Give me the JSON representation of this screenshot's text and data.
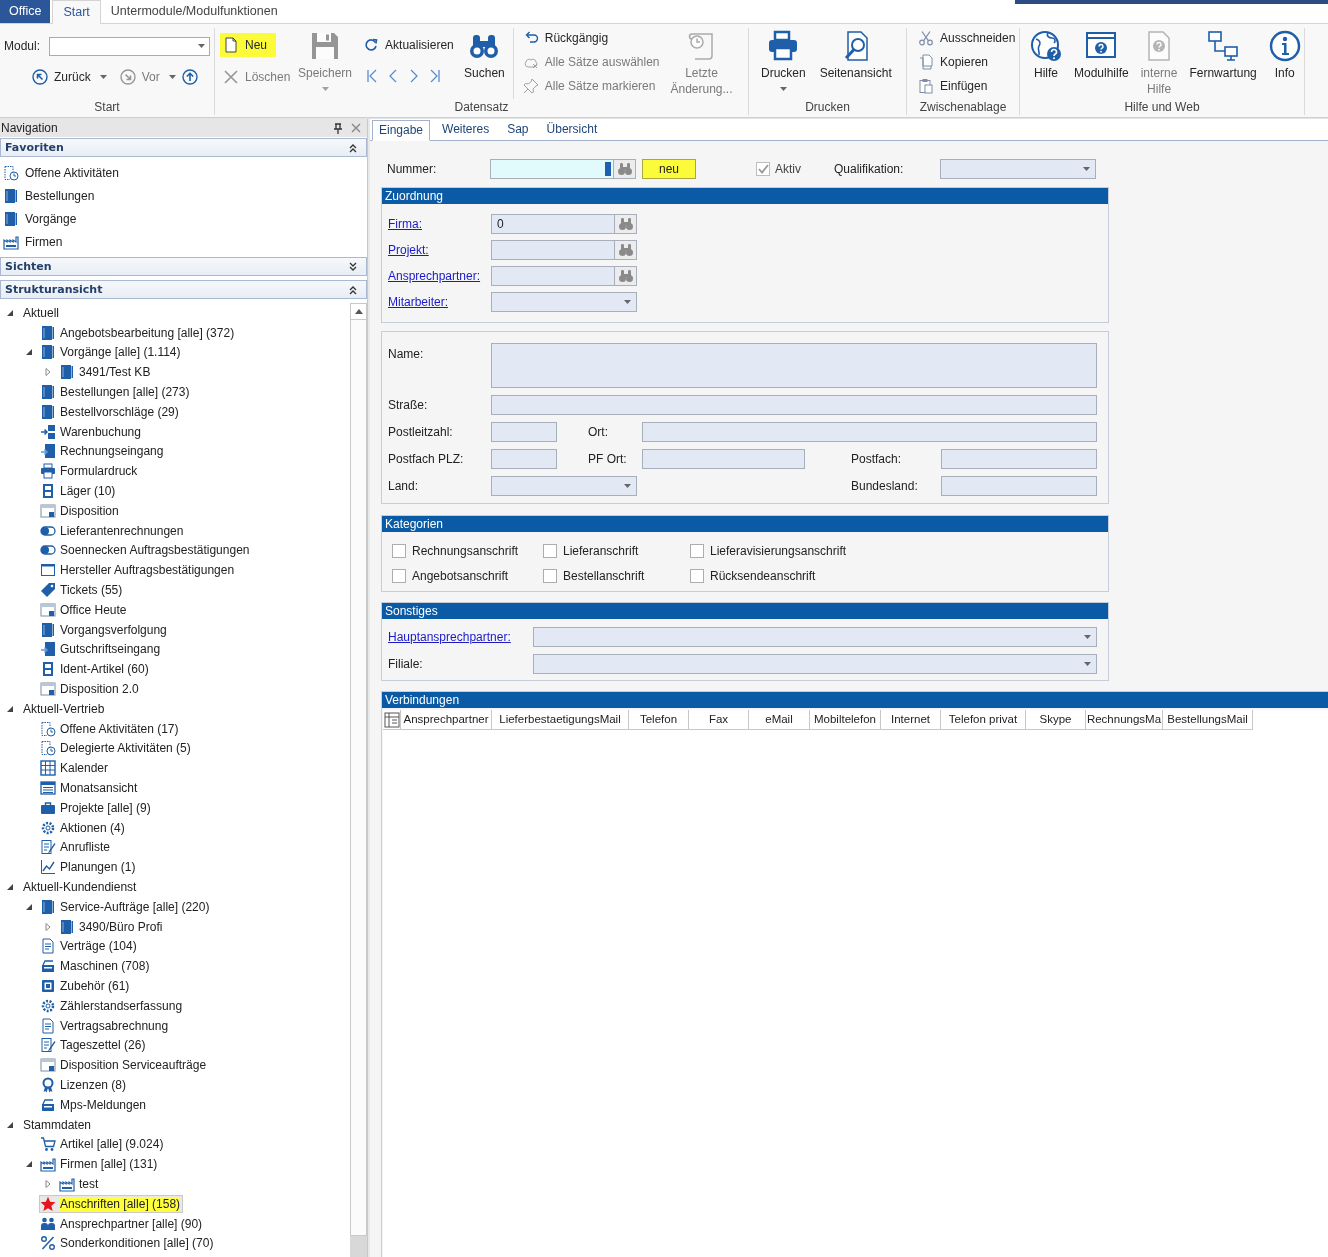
{
  "ribbon": {
    "tabs": [
      {
        "label": "Office",
        "kind": "file",
        "selected": false
      },
      {
        "label": "Start",
        "kind": "tab",
        "selected": true
      },
      {
        "label": "Untermodule/Modulfunktionen",
        "kind": "tab",
        "selected": false
      }
    ],
    "start_group": {
      "title": "Start",
      "module_label": "Modul:",
      "back": {
        "label": "Zurück",
        "disabled": false
      },
      "forward": {
        "label": "Vor",
        "disabled": true
      }
    },
    "record_group": {
      "title": "Datensatz",
      "buttons": [
        {
          "label": "Neu",
          "disabled": false,
          "highlighted": true
        },
        {
          "label": "Löschen",
          "disabled": true,
          "highlighted": false
        },
        {
          "label": "Speichern",
          "disabled": true,
          "highlighted": false
        },
        {
          "label": "Aktualisieren",
          "disabled": false,
          "highlighted": false
        },
        {
          "label": "Suchen",
          "disabled": false,
          "highlighted": false
        },
        {
          "label": "Rückgängig",
          "disabled": false,
          "highlighted": false
        },
        {
          "label": "Alle Sätze auswählen",
          "disabled": true,
          "highlighted": false
        },
        {
          "label": "Alle Sätze markieren",
          "disabled": true,
          "highlighted": false
        },
        {
          "label": "Letzte Änderung...",
          "disabled": true,
          "highlighted": false
        }
      ]
    },
    "print_group": {
      "title": "Drucken",
      "buttons": [
        {
          "label": "Drucken",
          "disabled": false
        },
        {
          "label": "Seitenansicht",
          "disabled": false
        }
      ]
    },
    "clipboard_group": {
      "title": "Zwischenablage",
      "buttons": [
        {
          "label": "Ausschneiden",
          "disabled": false
        },
        {
          "label": "Kopieren",
          "disabled": false
        },
        {
          "label": "Einfügen",
          "disabled": false
        }
      ]
    },
    "help_group": {
      "title": "Hilfe und Web",
      "buttons": [
        {
          "label": "Hilfe",
          "disabled": false
        },
        {
          "label": "Modulhilfe",
          "disabled": false
        },
        {
          "label": "interne Hilfe",
          "disabled": true
        },
        {
          "label": "Fernwartung",
          "disabled": false
        },
        {
          "label": "Info",
          "disabled": false
        }
      ]
    }
  },
  "navigation": {
    "title": "Navigation",
    "favorites": {
      "title": "Favoriten",
      "expanded": true,
      "items": [
        {
          "label": "Offene Aktivitäten"
        },
        {
          "label": "Bestellungen"
        },
        {
          "label": "Vorgänge"
        },
        {
          "label": "Firmen"
        }
      ]
    },
    "views": {
      "title": "Sichten",
      "expanded": false
    },
    "structure": {
      "title": "Strukturansicht",
      "expanded": true,
      "tree": [
        {
          "label": "Aktuell",
          "expanded": true,
          "selected": false,
          "highlighted": false,
          "children": [
            {
              "label": "Angebotsbearbeitung [alle] (372)",
              "selected": false,
              "highlighted": false
            },
            {
              "label": "Vorgänge [alle] (1.114)",
              "expanded": true,
              "selected": false,
              "highlighted": false,
              "children": [
                {
                  "label": "3491/Test KB",
                  "expanded": false,
                  "selected": false,
                  "highlighted": false
                }
              ]
            },
            {
              "label": "Bestellungen [alle] (273)",
              "selected": false,
              "highlighted": false
            },
            {
              "label": "Bestellvorschläge (29)",
              "selected": false,
              "highlighted": false
            },
            {
              "label": "Warenbuchung",
              "selected": false,
              "highlighted": false
            },
            {
              "label": "Rechnungseingang",
              "selected": false,
              "highlighted": false
            },
            {
              "label": "Formulardruck",
              "selected": false,
              "highlighted": false
            },
            {
              "label": "Läger (10)",
              "selected": false,
              "highlighted": false
            },
            {
              "label": "Disposition",
              "selected": false,
              "highlighted": false
            },
            {
              "label": "Lieferantenrechnungen",
              "selected": false,
              "highlighted": false
            },
            {
              "label": "Soennecken Auftragsbestätigungen",
              "selected": false,
              "highlighted": false
            },
            {
              "label": "Hersteller Auftragsbestätigungen",
              "selected": false,
              "highlighted": false
            },
            {
              "label": "Tickets (55)",
              "selected": false,
              "highlighted": false
            },
            {
              "label": "Office Heute",
              "selected": false,
              "highlighted": false
            },
            {
              "label": "Vorgangsverfolgung",
              "selected": false,
              "highlighted": false
            },
            {
              "label": "Gutschriftseingang",
              "selected": false,
              "highlighted": false
            },
            {
              "label": "Ident-Artikel (60)",
              "selected": false,
              "highlighted": false
            },
            {
              "label": "Disposition 2.0",
              "selected": false,
              "highlighted": false
            }
          ]
        },
        {
          "label": "Aktuell-Vertrieb",
          "expanded": true,
          "selected": false,
          "highlighted": false,
          "children": [
            {
              "label": "Offene Aktivitäten (17)",
              "selected": false,
              "highlighted": false
            },
            {
              "label": "Delegierte Aktivitäten (5)",
              "selected": false,
              "highlighted": false
            },
            {
              "label": "Kalender",
              "selected": false,
              "highlighted": false
            },
            {
              "label": "Monatsansicht",
              "selected": false,
              "highlighted": false
            },
            {
              "label": "Projekte [alle] (9)",
              "selected": false,
              "highlighted": false
            },
            {
              "label": "Aktionen (4)",
              "selected": false,
              "highlighted": false
            },
            {
              "label": "Anrufliste",
              "selected": false,
              "highlighted": false
            },
            {
              "label": "Planungen (1)",
              "selected": false,
              "highlighted": false
            }
          ]
        },
        {
          "label": "Aktuell-Kundendienst",
          "expanded": true,
          "selected": false,
          "highlighted": false,
          "children": [
            {
              "label": "Service-Aufträge [alle] (220)",
              "expanded": true,
              "selected": false,
              "highlighted": false,
              "children": [
                {
                  "label": "3490/Büro Profi",
                  "expanded": false,
                  "selected": false,
                  "highlighted": false
                }
              ]
            },
            {
              "label": "Verträge (104)",
              "selected": false,
              "highlighted": false
            },
            {
              "label": "Maschinen (708)",
              "selected": false,
              "highlighted": false
            },
            {
              "label": "Zubehör (61)",
              "selected": false,
              "highlighted": false
            },
            {
              "label": "Zählerstandserfassung",
              "selected": false,
              "highlighted": false
            },
            {
              "label": "Vertragsabrechnung",
              "selected": false,
              "highlighted": false
            },
            {
              "label": "Tageszettel (26)",
              "selected": false,
              "highlighted": false
            },
            {
              "label": "Disposition Serviceaufträge",
              "selected": false,
              "highlighted": false
            },
            {
              "label": "Lizenzen (8)",
              "selected": false,
              "highlighted": false
            },
            {
              "label": "Mps-Meldungen",
              "selected": false,
              "highlighted": false
            }
          ]
        },
        {
          "label": "Stammdaten",
          "expanded": true,
          "selected": false,
          "highlighted": false,
          "children": [
            {
              "label": "Artikel [alle] (9.024)",
              "selected": false,
              "highlighted": false
            },
            {
              "label": "Firmen [alle] (131)",
              "expanded": true,
              "selected": false,
              "highlighted": false,
              "children": [
                {
                  "label": "test",
                  "expanded": false,
                  "selected": false,
                  "highlighted": false
                }
              ]
            },
            {
              "label": "Anschriften [alle] (158)",
              "selected": true,
              "highlighted": true
            },
            {
              "label": "Ansprechpartner [alle] (90)",
              "selected": false,
              "highlighted": false
            },
            {
              "label": "Sonderkonditionen [alle] (70)",
              "selected": false,
              "highlighted": false
            }
          ]
        }
      ]
    }
  },
  "content": {
    "tabs": [
      {
        "label": "Eingabe",
        "selected": true
      },
      {
        "label": "Weiteres",
        "selected": false
      },
      {
        "label": "Sap",
        "selected": false
      },
      {
        "label": "Übersicht",
        "selected": false
      }
    ],
    "number": {
      "label": "Nummer:",
      "new_button": {
        "label": "neu",
        "highlighted": true
      }
    },
    "active": {
      "label": "Aktiv",
      "checked": true,
      "disabled": true
    },
    "qualification": {
      "label": "Qualifikation:"
    },
    "assignment": {
      "title": "Zuordnung",
      "fields": [
        {
          "label": "Firma:",
          "link": true,
          "kind": "lookup",
          "value": "0"
        },
        {
          "label": "Projekt:",
          "link": true,
          "kind": "lookup"
        },
        {
          "label": "Ansprechpartner:",
          "link": true,
          "kind": "lookup"
        },
        {
          "label": "Mitarbeiter:",
          "link": true,
          "kind": "dropdown"
        }
      ]
    },
    "address": {
      "name_label": "Name:",
      "street_label": "Straße:",
      "zip_label": "Postleitzahl:",
      "city_label": "Ort:",
      "po_zip_label": "Postfach PLZ:",
      "po_city_label": "PF Ort:",
      "po_box_label": "Postfach:",
      "country_label": "Land:",
      "state_label": "Bundesland:"
    },
    "categories": {
      "title": "Kategorien",
      "items": [
        {
          "label": "Rechnungsanschrift",
          "checked": false
        },
        {
          "label": "Lieferanschrift",
          "checked": false
        },
        {
          "label": "Lieferavisierungsanschrift",
          "checked": false
        },
        {
          "label": "Angebotsanschrift",
          "checked": false
        },
        {
          "label": "Bestellanschrift",
          "checked": false
        },
        {
          "label": "Rücksendeanschrift",
          "checked": false
        }
      ]
    },
    "misc": {
      "title": "Sonstiges",
      "fields": [
        {
          "label": "Hauptansprechpartner:",
          "link": true
        },
        {
          "label": "Filiale:",
          "link": false
        }
      ]
    },
    "connections": {
      "title": "Verbindungen",
      "columns": [
        "Ansprechpartner",
        "LieferbestaetigungsMail",
        "Telefon",
        "Fax",
        "eMail",
        "Mobiltelefon",
        "Internet",
        "Telefon privat",
        "Skype",
        "RechnungsMa",
        "BestellungsMail"
      ]
    }
  }
}
